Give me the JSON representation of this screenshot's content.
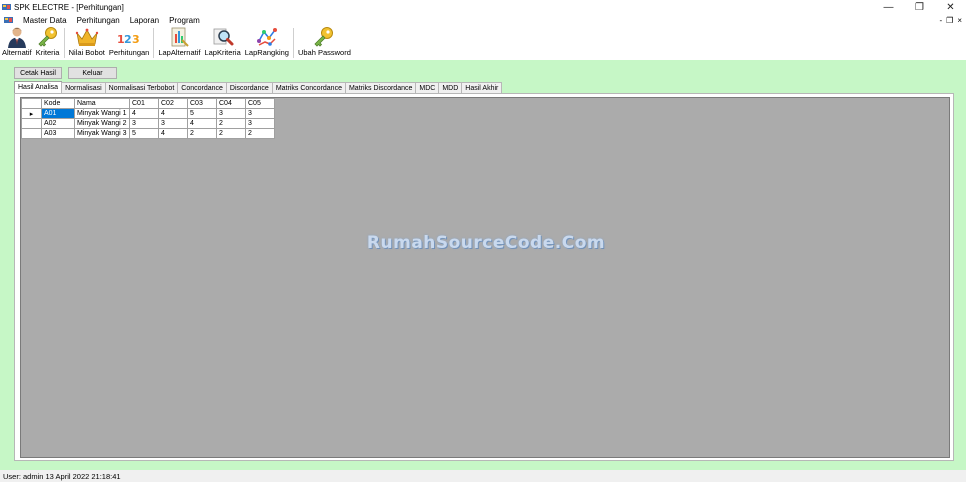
{
  "window": {
    "title": "SPK ELECTRE - [Perhitungan]",
    "controls": {
      "minimize": "—",
      "restore": "❐",
      "close": "✕"
    }
  },
  "menubar": {
    "items": [
      "Master Data",
      "Perhitungan",
      "Laporan",
      "Program"
    ],
    "mdi_controls": {
      "minimize": "-",
      "restore": "❐",
      "close": "×"
    }
  },
  "toolbar": {
    "buttons": [
      {
        "label": "Alternatif",
        "icon": "person-icon"
      },
      {
        "label": "Kriteria",
        "icon": "key-icon"
      },
      {
        "label": "Nilai Bobot",
        "icon": "crown-icon"
      },
      {
        "label": "Perhitungan",
        "icon": "numbers-icon"
      },
      {
        "label": "LapAlternatif",
        "icon": "report-icon"
      },
      {
        "label": "LapKriteria",
        "icon": "magnifier-icon"
      },
      {
        "label": "LapRangking",
        "icon": "network-icon"
      },
      {
        "label": "Ubah Password",
        "icon": "key-icon"
      }
    ]
  },
  "actions": {
    "print": "Cetak Hasil",
    "exit": "Keluar"
  },
  "tabs": [
    "Hasil Analisa",
    "Normalisasi",
    "Normalisasi Terbobot",
    "Concordance",
    "Discordance",
    "Matriks Concordance",
    "Matriks Discordance",
    "MDC",
    "MDD",
    "Hasil Akhir"
  ],
  "active_tab": "Hasil Analisa",
  "grid": {
    "columns": [
      "Kode",
      "Nama",
      "C01",
      "C02",
      "C03",
      "C04",
      "C05"
    ],
    "rows": [
      [
        "A01",
        "Minyak Wangi 1",
        "4",
        "4",
        "5",
        "3",
        "3"
      ],
      [
        "A02",
        "Minyak Wangi 2",
        "3",
        "3",
        "4",
        "2",
        "3"
      ],
      [
        "A03",
        "Minyak Wangi 3",
        "5",
        "4",
        "2",
        "2",
        "2"
      ]
    ],
    "row_indicator": "▸"
  },
  "watermark": "RumahSourceCode.Com",
  "status": "User: admin  13 April 2022 21:18:41",
  "colors": {
    "form_background": "#c6f7c6",
    "grid_background": "#ababab",
    "selection": "#0078d7"
  }
}
